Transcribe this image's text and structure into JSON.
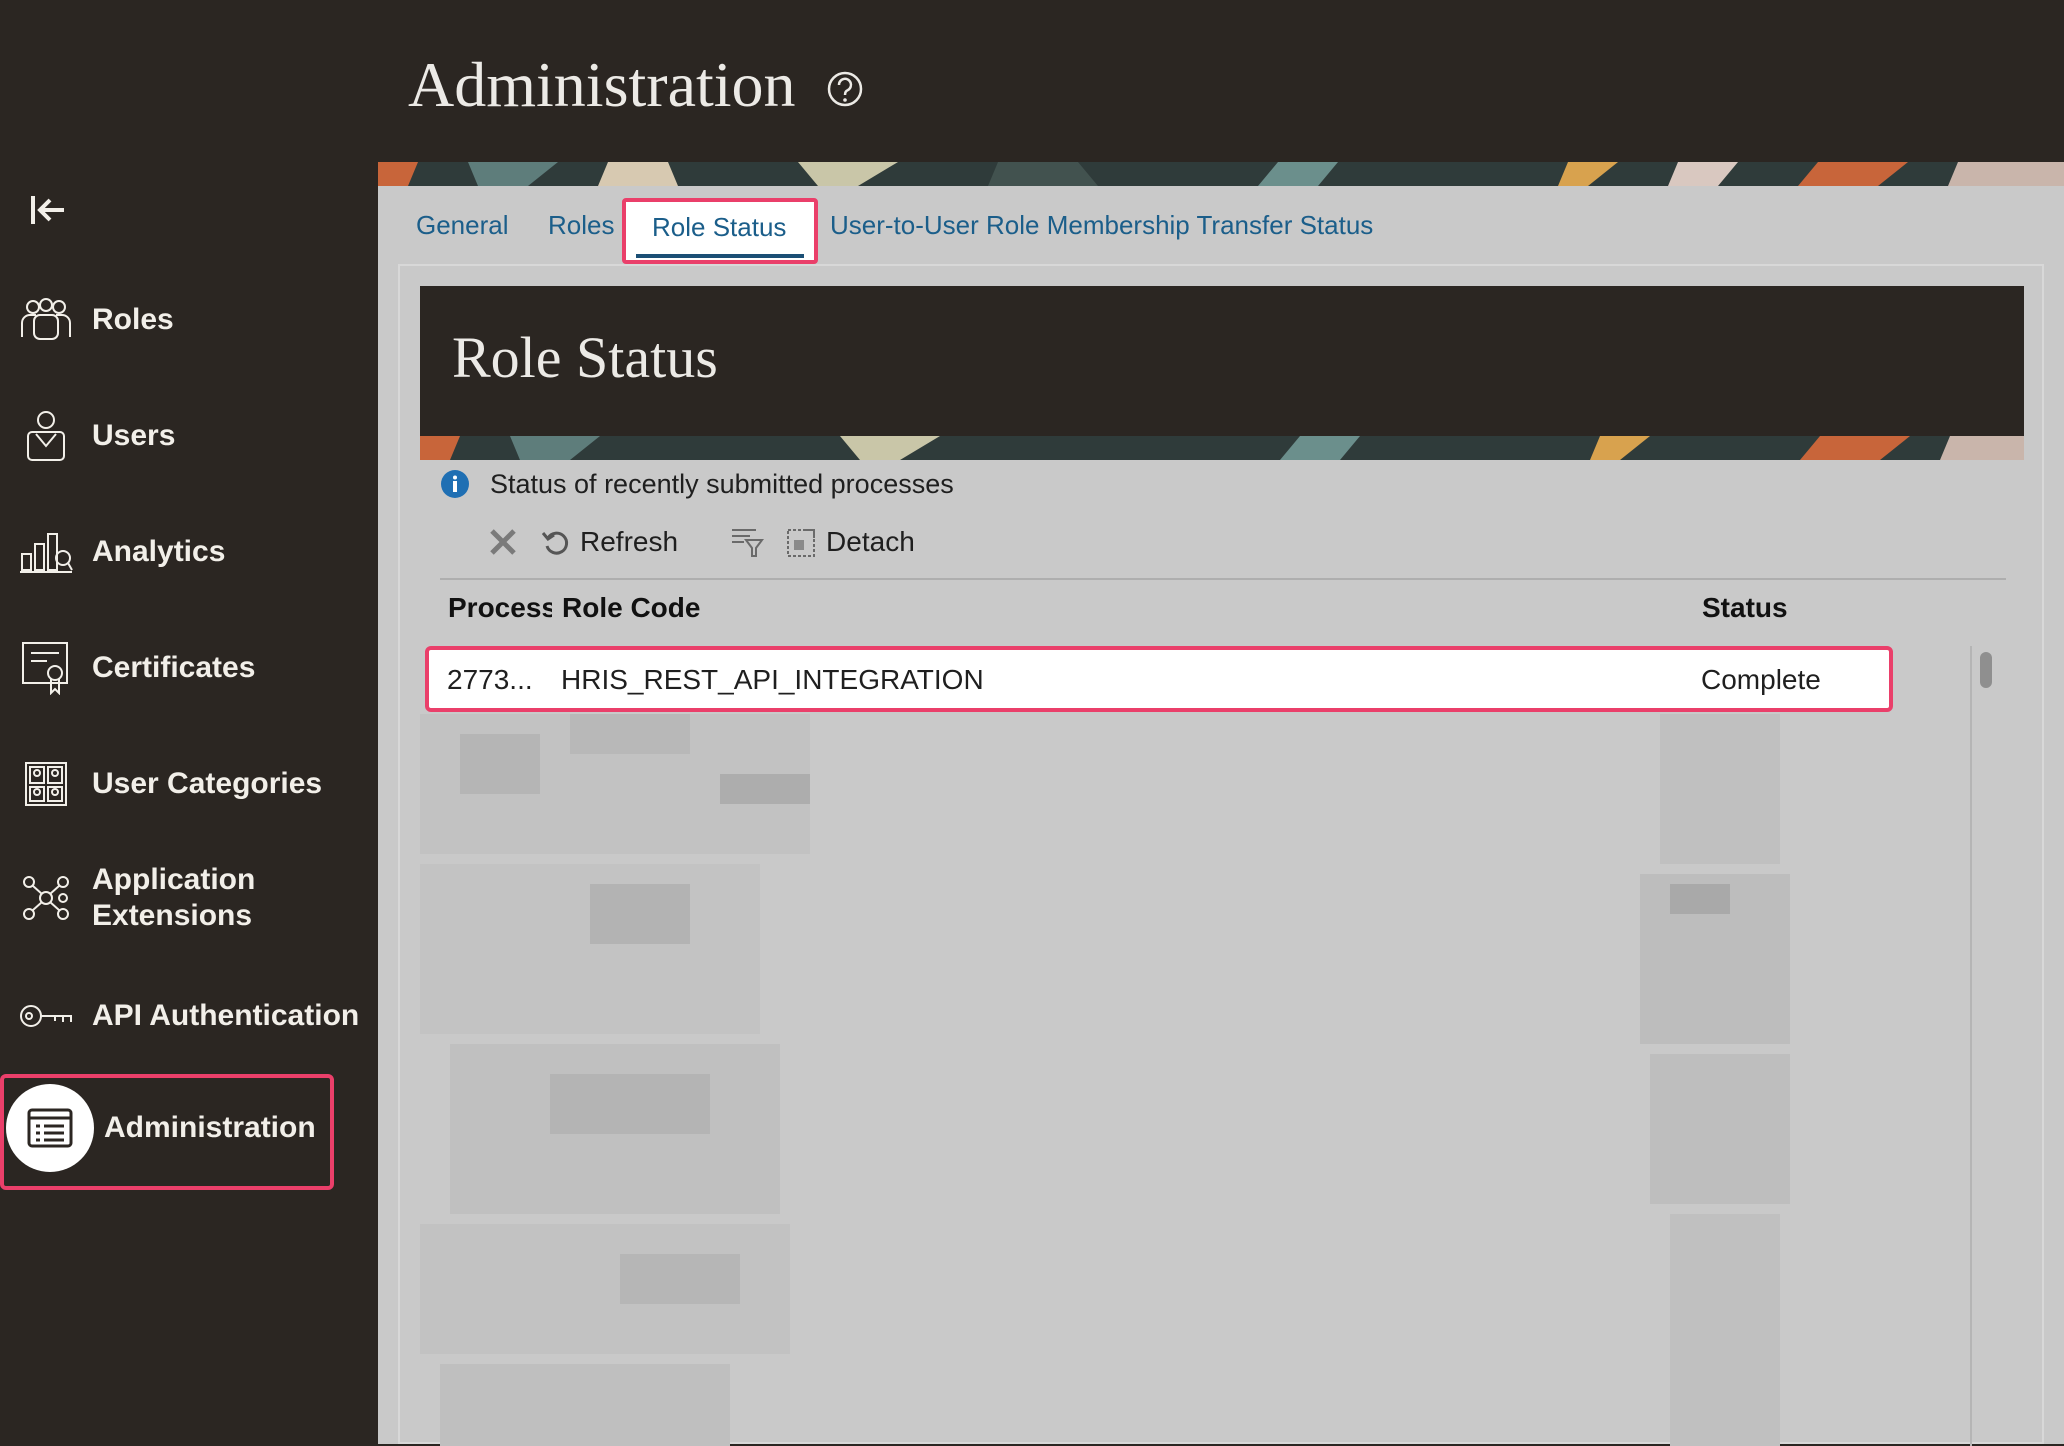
{
  "header": {
    "title": "Administration"
  },
  "sidebar": {
    "items": [
      {
        "label": "Roles",
        "icon": "roles-icon"
      },
      {
        "label": "Users",
        "icon": "user-icon"
      },
      {
        "label": "Analytics",
        "icon": "analytics-icon"
      },
      {
        "label": "Certificates",
        "icon": "certificate-icon"
      },
      {
        "label": "User Categories",
        "icon": "user-categories-icon"
      },
      {
        "label": "Application Extensions",
        "icon": "extensions-icon"
      },
      {
        "label": "API Authentication",
        "icon": "key-icon"
      },
      {
        "label": "Administration",
        "icon": "administration-icon",
        "active": true
      }
    ]
  },
  "tabs": [
    {
      "label": "General"
    },
    {
      "label": "Roles"
    },
    {
      "label": "Role Status",
      "active": true
    },
    {
      "label": "User-to-User Role Membership Transfer Status"
    }
  ],
  "panel": {
    "title": "Role Status",
    "info": "Status of recently submitted processes",
    "toolbar": {
      "refresh_label": "Refresh",
      "detach_label": "Detach"
    },
    "table": {
      "columns": [
        "Process",
        "Role Code",
        "Status"
      ],
      "rows": [
        {
          "process": "2773...",
          "role_code": "HRIS_REST_API_INTEGRATION",
          "status": "Complete"
        }
      ]
    }
  },
  "colors": {
    "accent": "#ea3f6a",
    "link": "#1b5e8a",
    "dark_bg": "#2b2622",
    "panel_bg": "#c9c9c9"
  }
}
